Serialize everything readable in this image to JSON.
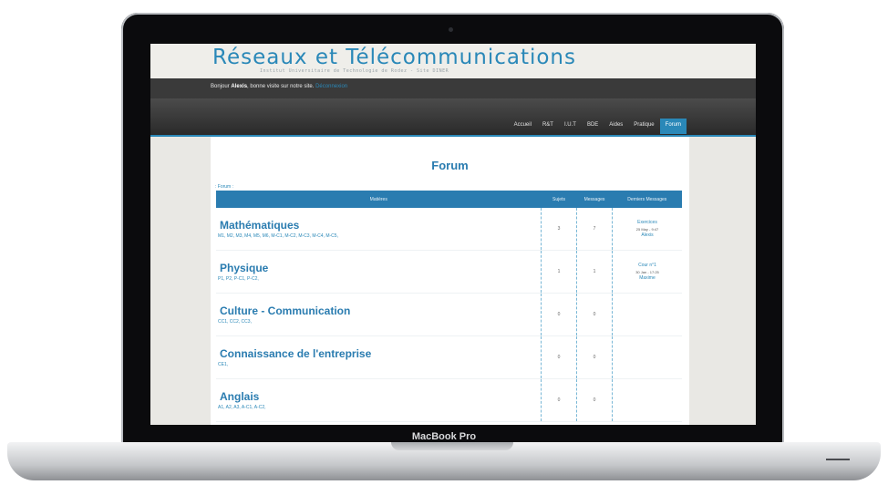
{
  "device": {
    "label": "MacBook Pro"
  },
  "site": {
    "title": "Réseaux et Télécommunications",
    "subtitle": "Institut Universitaire de Technologie de Rodez - Site DINER",
    "welcome": {
      "prefix": "Bonjour ",
      "user": "Alexis",
      "suffix": ", bonne visite sur notre site. ",
      "logout": "Déconnexion"
    },
    "nav": [
      {
        "label": "Accueil"
      },
      {
        "label": "R&T"
      },
      {
        "label": "I.U.T"
      },
      {
        "label": "BDE"
      },
      {
        "label": "Aides"
      },
      {
        "label": "Pratique"
      },
      {
        "label": "Forum",
        "active": true
      }
    ]
  },
  "forum": {
    "title": "Forum",
    "breadcrumb": ": Forum :",
    "headers": {
      "matieres": "Matières",
      "sujets": "Sujets",
      "messages": "Messages",
      "derniers": "Derniers Messages"
    },
    "rows": [
      {
        "name": "Mathématiques",
        "sub": "M1, M2, M3, M4, M5, M6, M-C1, M-C2, M-C3, M-C4, M-C5,",
        "sujets": "3",
        "messages": "7",
        "last": {
          "title": "Exercices",
          "date": "25 May - 9:47",
          "author": "Alexis"
        }
      },
      {
        "name": "Physique",
        "sub": "P1, P2, P-C1, P-C2,",
        "sujets": "1",
        "messages": "1",
        "last": {
          "title": "Cour n°1",
          "date": "30 Jan - 17:25",
          "author": "Maxime"
        }
      },
      {
        "name": "Culture - Communication",
        "sub": "CC1, CC2, CC3,",
        "sujets": "0",
        "messages": "0",
        "last": {
          "title": "",
          "date": "",
          "author": ""
        }
      },
      {
        "name": "Connaissance de l'entreprise",
        "sub": "CE1,",
        "sujets": "0",
        "messages": "0",
        "last": {
          "title": "",
          "date": "",
          "author": ""
        }
      },
      {
        "name": "Anglais",
        "sub": "A1, A2, A3, A-C1, A-C2,",
        "sujets": "0",
        "messages": "0",
        "last": {
          "title": "",
          "date": "",
          "author": ""
        }
      }
    ]
  }
}
